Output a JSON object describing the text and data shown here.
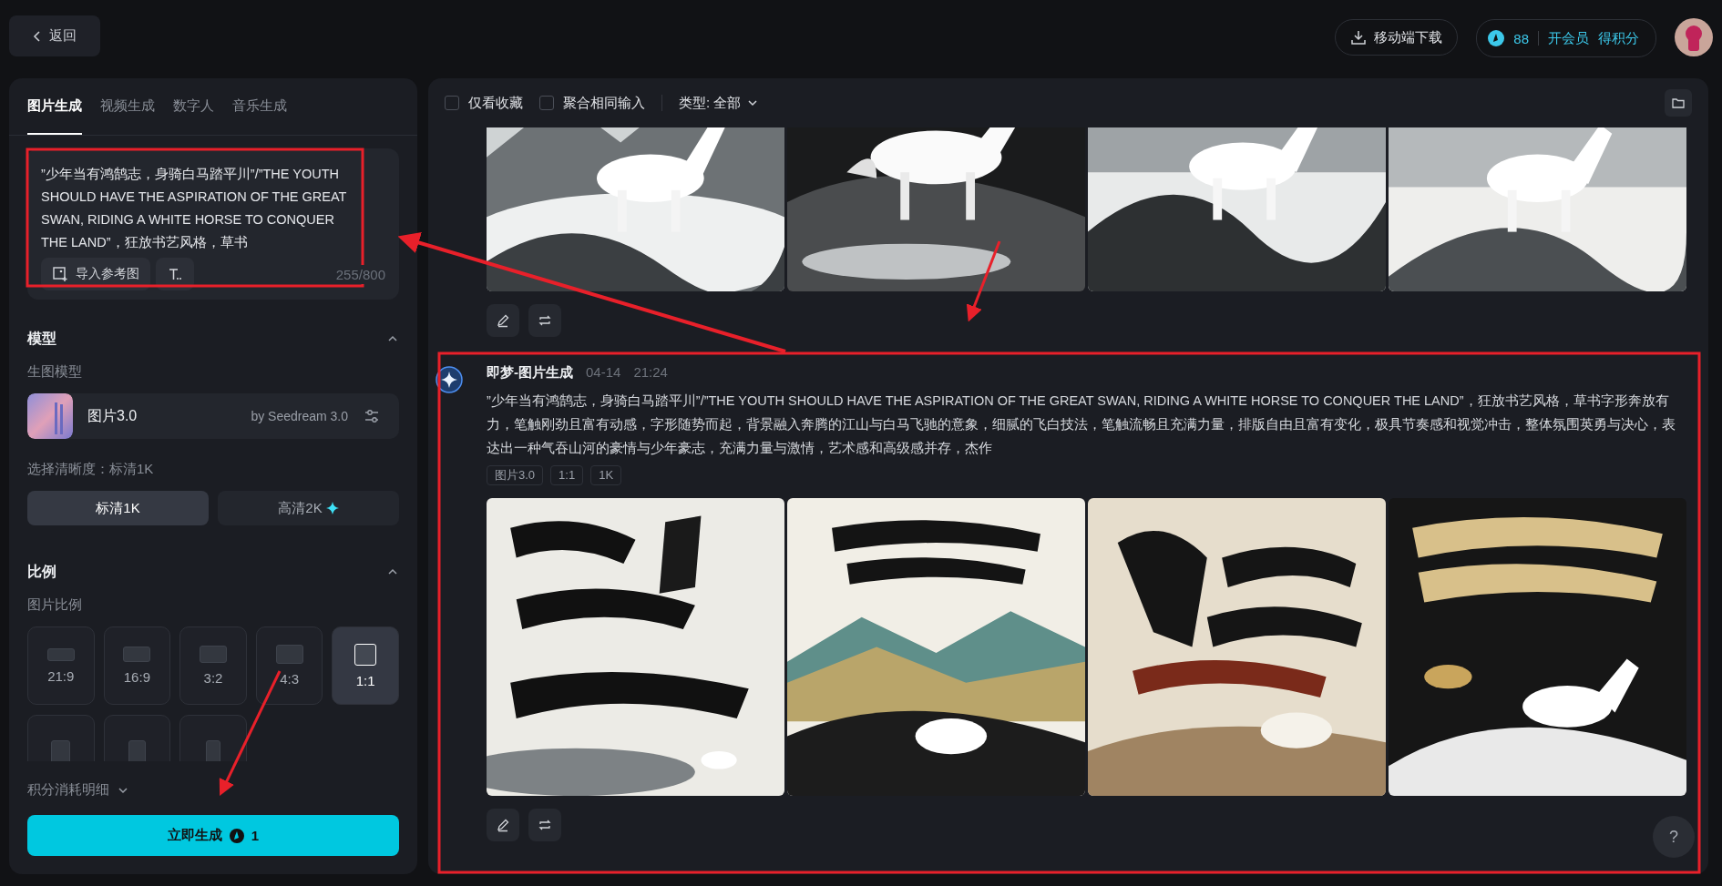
{
  "back_button": {
    "label": "返回"
  },
  "header": {
    "download_button": "移动端下载",
    "credits": "88",
    "membership_link": "开会员",
    "earn_link": "得积分"
  },
  "left_panel": {
    "tabs": [
      {
        "label": "图片生成",
        "selected": true
      },
      {
        "label": "视频生成",
        "selected": false
      },
      {
        "label": "数字人",
        "selected": false
      },
      {
        "label": "音乐生成",
        "selected": false
      }
    ],
    "prompt": {
      "value": "”少年当有鸿鹄志，身骑白马踏平川”/”THE YOUTH SHOULD HAVE THE ASPIRATION OF THE GREAT SWAN, RIDING A WHITE HORSE TO CONQUER THE LAND”，狂放书艺风格，草书",
      "import_button": "导入参考图",
      "counter": "255/800"
    },
    "model": {
      "title": "模型",
      "expanded": true,
      "label": "生图模型",
      "name": "图片3.0",
      "by": "by Seedream 3.0",
      "quality_label": "选择清晰度：标清1K",
      "quality_options": [
        {
          "label": "标清1K",
          "selected": true,
          "premium": false
        },
        {
          "label": "高清2K",
          "selected": false,
          "premium": true
        }
      ]
    },
    "ratio": {
      "title": "比例",
      "expanded": true,
      "label": "图片比例",
      "options": [
        {
          "label": "21:9",
          "kind": "wide",
          "selected": false
        },
        {
          "label": "16:9",
          "kind": "landscape",
          "selected": false
        },
        {
          "label": "3:2",
          "selected": false
        },
        {
          "label": "4:3",
          "kind": "classic",
          "selected": false
        },
        {
          "label": "1:1",
          "kind": "square",
          "selected": true
        },
        {
          "kind": "portrait",
          "selected": false
        },
        {
          "kind": "tall",
          "selected": false
        },
        {
          "kind": "narrow",
          "selected": false
        }
      ]
    },
    "cost_details": {
      "label": "积分消耗明细",
      "expanded": false
    },
    "generate_button": {
      "label": "立即生成",
      "cost": "1"
    }
  },
  "right_panel": {
    "filters": [
      {
        "label": "仅看收藏",
        "checked": false
      },
      {
        "label": "聚合相同输入",
        "checked": false
      }
    ],
    "type_filter": "类型: 全部",
    "groups": [
      {
        "images": [
          {
            "kind": "picture"
          },
          {
            "kind": "picture"
          },
          {
            "kind": "picture"
          },
          {
            "kind": "picture"
          }
        ]
      },
      {
        "author": "即梦-图片生成",
        "date": "04-14",
        "time": "21:24",
        "prompt": "”少年当有鸿鹄志，身骑白马踏平川”/”THE YOUTH SHOULD HAVE THE ASPIRATION OF THE GREAT SWAN, RIDING A WHITE HORSE TO CONQUER THE LAND”，狂放书艺风格，草书字形奔放有力，笔触刚劲且富有动感，字形随势而起，背景融入奔腾的江山与白马飞驰的意象，细腻的飞白技法，笔触流畅且充满力量，排版自由且富有变化，极具节奏感和视觉冲击，整体氛围英勇与决心，表达出一种气吞山河的豪情与少年豪志，充满力量与激情，艺术感和高级感并存，杰作",
        "tags": [
          "图片3.0",
          "1:1",
          "1K"
        ],
        "images": [
          {
            "kind": "picture"
          },
          {
            "kind": "picture"
          },
          {
            "kind": "picture"
          },
          {
            "kind": "picture"
          }
        ]
      }
    ],
    "help_button": "?"
  }
}
